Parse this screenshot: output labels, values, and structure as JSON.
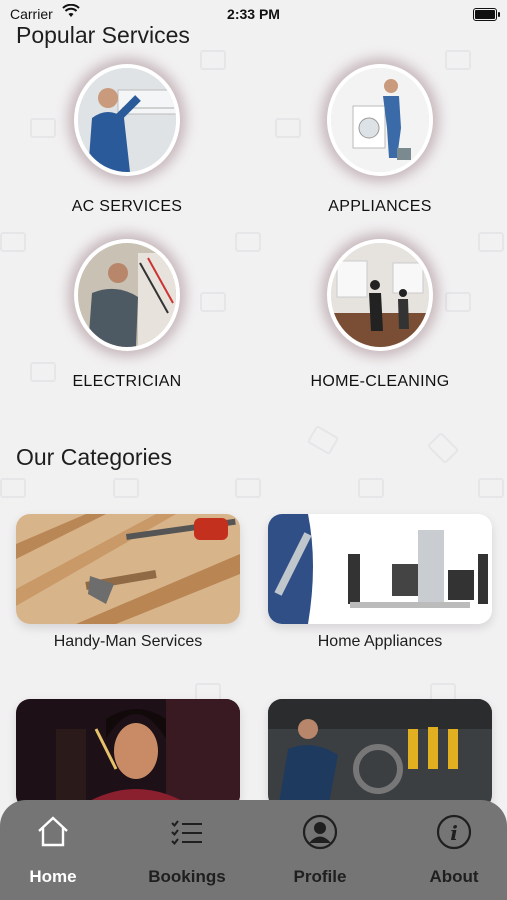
{
  "status_bar": {
    "carrier": "Carrier",
    "time": "2:33 PM"
  },
  "popular": {
    "title": "Popular Services",
    "items": [
      {
        "label": "AC SERVICES"
      },
      {
        "label": "APPLIANCES"
      },
      {
        "label": "ELECTRICIAN"
      },
      {
        "label": "HOME-CLEANING"
      }
    ]
  },
  "categories": {
    "title": "Our Categories",
    "items": [
      {
        "label": "Handy-Man Services"
      },
      {
        "label": "Home Appliances"
      },
      {
        "label": ""
      },
      {
        "label": ""
      }
    ]
  },
  "tabbar": {
    "tabs": [
      {
        "label": "Home",
        "icon": "home-icon",
        "active": true
      },
      {
        "label": "Bookings",
        "icon": "list-icon"
      },
      {
        "label": "Profile",
        "icon": "profile-icon"
      },
      {
        "label": "About",
        "icon": "info-icon"
      }
    ],
    "colors": {
      "bar": "#757575",
      "active": "#ffffff",
      "inactive": "#1f1f1f"
    }
  }
}
